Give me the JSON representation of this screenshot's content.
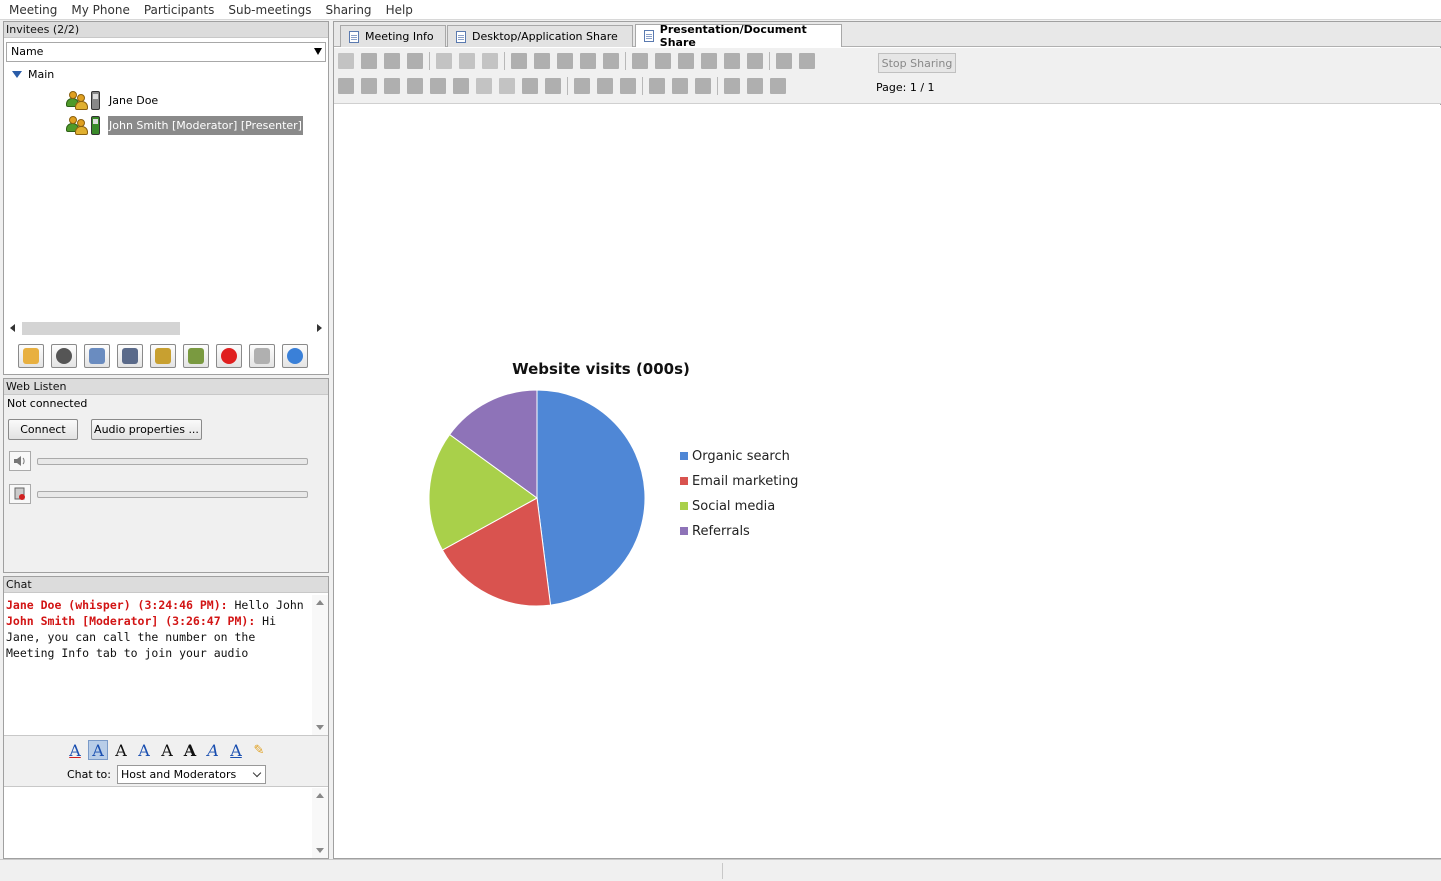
{
  "menu": [
    "Meeting",
    "My Phone",
    "Participants",
    "Sub-meetings",
    "Sharing",
    "Help"
  ],
  "invitees": {
    "header": "Invitees (2/2)",
    "column": "Name",
    "group": "Main",
    "participants": [
      {
        "name": "Jane Doe",
        "selected": false
      },
      {
        "name": "John Smith [Moderator] [Presenter]",
        "selected": true
      }
    ],
    "toolbar_icons": [
      "raise-hand-icon",
      "dialpad-icon",
      "phone-settings-icon",
      "screen-settings-icon",
      "add-participant-icon",
      "group-settings-icon",
      "record-icon",
      "broadcast-icon",
      "pause-icon"
    ]
  },
  "weblisten": {
    "header": "Web Listen",
    "status": "Not connected",
    "connect_label": "Connect",
    "audio_label": "Audio properties ..."
  },
  "chat": {
    "header": "Chat",
    "messages": [
      {
        "sender": "Jane Doe (whisper) (3:24:46 PM):",
        "text": " Hello John"
      },
      {
        "sender": "John Smith [Moderator] (3:26:47 PM):",
        "text": "  Hi Jane, you can call the number on the Meeting Info tab to join your audio"
      }
    ],
    "chat_to_label": "Chat to:",
    "chat_to_value": "Host and Moderators",
    "input_value": ""
  },
  "tabs": [
    {
      "label": "Meeting Info",
      "active": false
    },
    {
      "label": "Desktop/Application Share",
      "active": false
    },
    {
      "label": "Presentation/Document Share",
      "active": true
    }
  ],
  "share": {
    "stop_label": "Stop Sharing",
    "page_label": "Page: 1 / 1"
  },
  "chart_data": {
    "type": "pie",
    "title": "Website visits (000s)",
    "categories": [
      "Organic search",
      "Email marketing",
      "Social media",
      "Referrals"
    ],
    "values": [
      48,
      19,
      18,
      15
    ],
    "colors": [
      "#4f87d6",
      "#d9534f",
      "#a9d04a",
      "#8e73b8"
    ],
    "legend": "right"
  }
}
